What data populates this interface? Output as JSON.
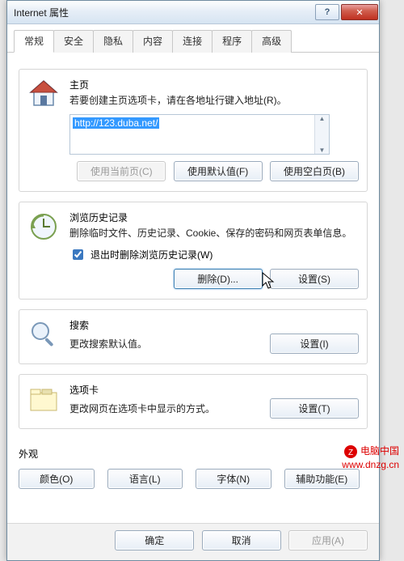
{
  "window": {
    "title": "Internet 属性"
  },
  "tabs": [
    "常规",
    "安全",
    "隐私",
    "内容",
    "连接",
    "程序",
    "高级"
  ],
  "active_tab": 0,
  "home": {
    "legend": "主页",
    "desc": "若要创建主页选项卡，请在各地址行键入地址(R)。",
    "url": "http://123.duba.net/",
    "buttons": {
      "current": "使用当前页(C)",
      "default": "使用默认值(F)",
      "blank": "使用空白页(B)"
    }
  },
  "history": {
    "legend": "浏览历史记录",
    "desc": "删除临时文件、历史记录、Cookie、保存的密码和网页表单信息。",
    "checkbox_label": "退出时删除浏览历史记录(W)",
    "checked": true,
    "buttons": {
      "delete": "删除(D)...",
      "settings": "设置(S)"
    }
  },
  "search": {
    "legend": "搜索",
    "desc": "更改搜索默认值。",
    "button": "设置(I)"
  },
  "tabs_section": {
    "legend": "选项卡",
    "desc": "更改网页在选项卡中显示的方式。",
    "button": "设置(T)"
  },
  "appearance": {
    "legend": "外观",
    "buttons": {
      "colors": "颜色(O)",
      "languages": "语言(L)",
      "fonts": "字体(N)",
      "accessibility": "辅助功能(E)"
    }
  },
  "footer": {
    "ok": "确定",
    "cancel": "取消",
    "apply": "应用(A)"
  },
  "watermark": {
    "line1": "电脑中国",
    "line2": "www.dnzg.cn"
  }
}
